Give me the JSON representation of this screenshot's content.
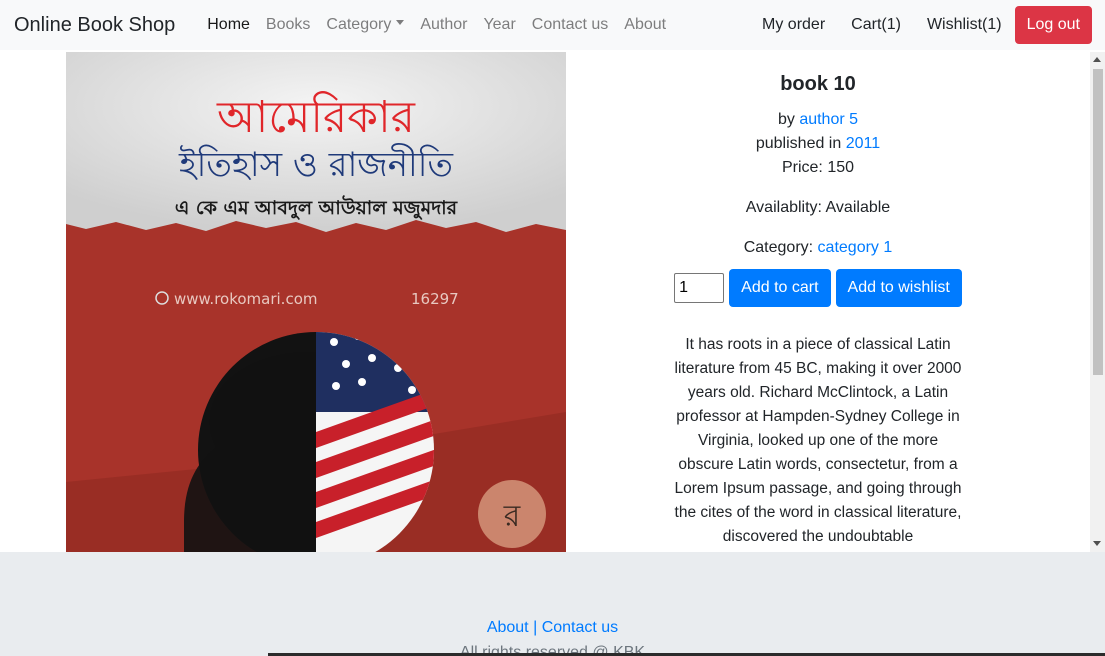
{
  "navbar": {
    "brand": "Online Book Shop",
    "links": {
      "home": "Home",
      "books": "Books",
      "category": "Category",
      "author": "Author",
      "year": "Year",
      "contact": "Contact us",
      "about": "About"
    },
    "right": {
      "my_order": "My order",
      "cart": "Cart(1)",
      "wishlist": "Wishlist(1)",
      "logout": "Log out"
    }
  },
  "book": {
    "cover": {
      "title_bn_1": "আমেরিকার",
      "title_bn_2": "ইতিহাস ও রাজনীতি",
      "author_bn": "এ কে এম আবদুল আউয়াল মজুমদার",
      "website": "www.rokomari.com",
      "phone": "16297",
      "publisher_mark": "র"
    },
    "title": "book 10",
    "by_label": "by",
    "author": "author 5",
    "published_label": "published in",
    "year": "2011",
    "price_text": "Price: 150",
    "availability_text": "Availablity: Available",
    "category_label": "Category:",
    "category": "category 1",
    "quantity": "1",
    "add_to_cart": "Add to cart",
    "add_to_wishlist": "Add to wishlist",
    "description": "It has roots in a piece of classical Latin literature from 45 BC, making it over 2000 years old. Richard McClintock, a Latin professor at Hampden-Sydney College in Virginia, looked up one of the more obscure Latin words, consectetur, from a Lorem Ipsum passage, and going through the cites of the word in classical literature, discovered the undoubtable"
  },
  "footer": {
    "about": "About",
    "separator": "|",
    "contact": "Contact us",
    "copyright": "All rights reserved @ KBK"
  },
  "colors": {
    "link": "#007bff",
    "danger": "#dc3545",
    "cover_red": "#a8332a"
  }
}
